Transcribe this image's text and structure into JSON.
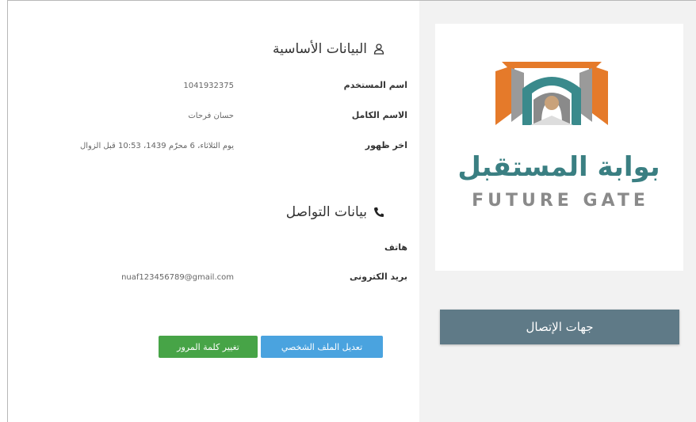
{
  "basic_info": {
    "title": "البيانات الأساسية",
    "icon": "user-icon",
    "rows": [
      {
        "label": "اسم المستخدم",
        "value": "1041932375"
      },
      {
        "label": "الاسم الكامل",
        "value": "حسان فرحات"
      },
      {
        "label": "اخر ظهور",
        "value": "يوم الثلاثاء، 6 محرّم 1439، 10:53 قبل الزوال"
      }
    ]
  },
  "contact_info": {
    "title": "بيانات التواصل",
    "icon": "phone-icon",
    "rows": [
      {
        "label": "هاتف",
        "value": ""
      },
      {
        "label": "بريد الكترونى",
        "value": "nuaf123456789@gmail.com"
      }
    ]
  },
  "buttons": {
    "edit_profile": "تعديل الملف الشخصي",
    "change_password": "تغيير كلمة المرور"
  },
  "logo": {
    "arabic": "بوابة المستقبل",
    "english": "FUTURE GATE"
  },
  "contacts_button": "جهات الإتصال",
  "colors": {
    "panel_bg": "#f2f2f2",
    "contacts_button_bg": "#5f7a87",
    "edit_button_bg": "#4aa3df",
    "password_button_bg": "#47a447",
    "logo_orange": "#e57a2a",
    "logo_teal": "#3a8a8c",
    "logo_gray": "#8a8a8a"
  }
}
